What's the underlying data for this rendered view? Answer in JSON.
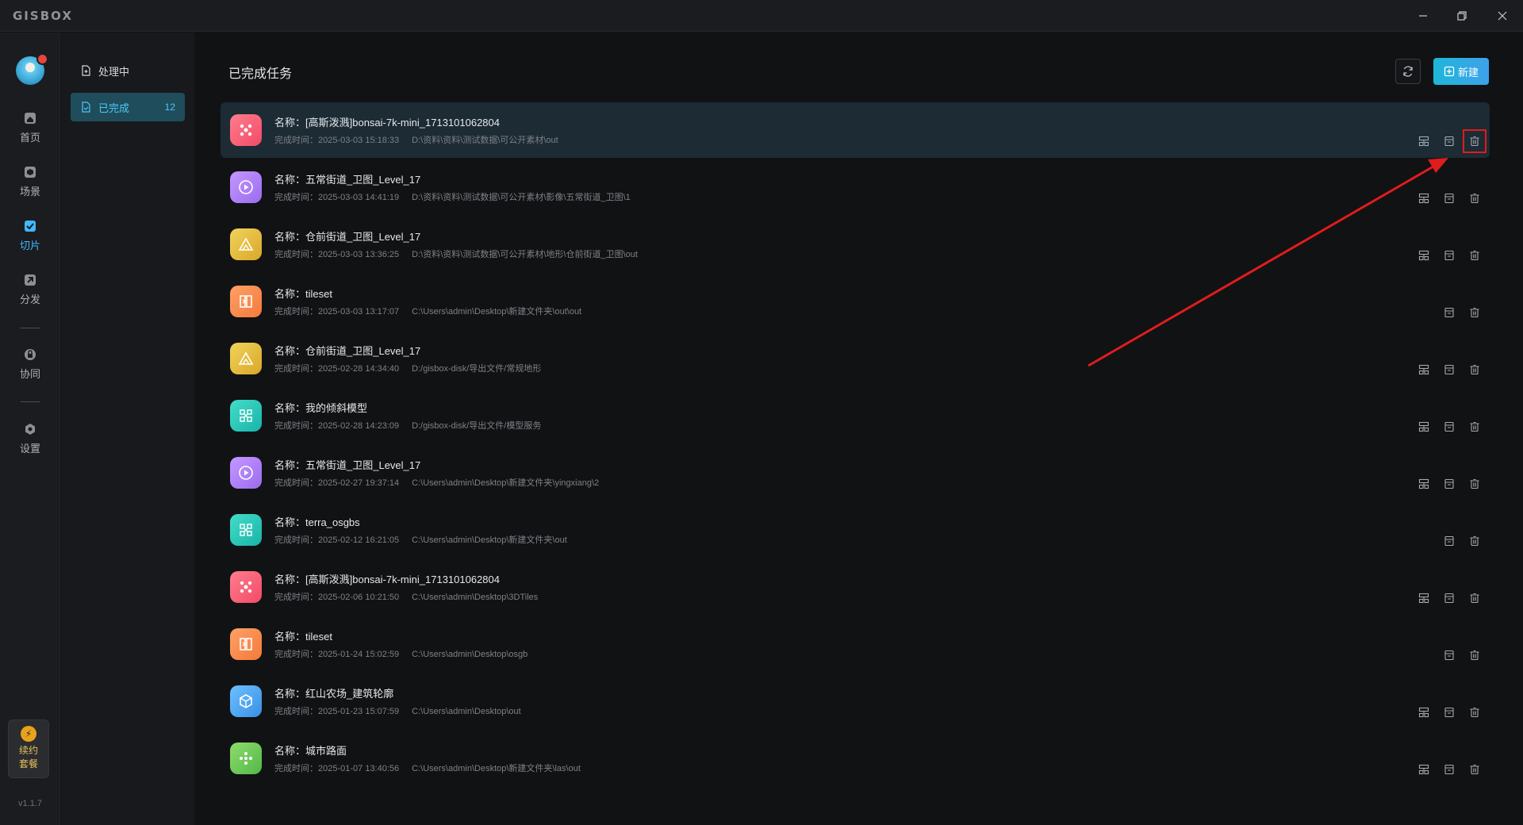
{
  "app": {
    "logo": "GISBOX",
    "version": "v1.1.7"
  },
  "rail": {
    "items": [
      {
        "label": "首页",
        "icon": "home-icon",
        "active": false
      },
      {
        "label": "场景",
        "icon": "scene-icon",
        "active": false
      },
      {
        "label": "切片",
        "icon": "slice-icon",
        "active": true
      },
      {
        "label": "分发",
        "icon": "distribute-icon",
        "active": false
      },
      {
        "label": "协同",
        "icon": "collaborate-icon",
        "active": false
      },
      {
        "label": "设置",
        "icon": "settings-icon",
        "active": false
      }
    ],
    "renew_line1": "续约",
    "renew_line2": "套餐"
  },
  "subnav": {
    "processing": "处理中",
    "completed": "已完成",
    "completed_count": "12"
  },
  "main": {
    "title": "已完成任务",
    "new_label": "新建",
    "name_prefix": "名称：",
    "time_prefix": "完成时间：",
    "tasks": [
      {
        "name": "[高斯泼溅]bonsai-7k-mini_1713101062804",
        "time": "2025-03-03 15:18:33",
        "path": "D:\\资料\\资料\\测试数据\\可公开素材\\out",
        "color": "pink",
        "icon": "gaussian-splat-icon",
        "selected": true,
        "has_publish": true
      },
      {
        "name": "五常街道_卫图_Level_17",
        "time": "2025-03-03 14:41:19",
        "path": "D:\\资料\\资料\\测试数据\\可公开素材\\影像\\五常街道_卫图\\1",
        "color": "purple",
        "icon": "imagery-icon",
        "selected": false,
        "has_publish": true
      },
      {
        "name": "仓前街道_卫图_Level_17",
        "time": "2025-03-03 13:36:25",
        "path": "D:\\资料\\资料\\测试数据\\可公开素材\\地形\\仓前街道_卫图\\out",
        "color": "yellow",
        "icon": "terrain-icon",
        "selected": false,
        "has_publish": true
      },
      {
        "name": "tileset",
        "time": "2025-03-03 13:17:07",
        "path": "C:\\Users\\admin\\Desktop\\新建文件夹\\out\\out",
        "color": "orange",
        "icon": "tileset-icon",
        "selected": false,
        "has_publish": false
      },
      {
        "name": "仓前街道_卫图_Level_17",
        "time": "2025-02-28 14:34:40",
        "path": "D:/gisbox-disk/导出文件/常规地形",
        "color": "yellow",
        "icon": "terrain-icon",
        "selected": false,
        "has_publish": true
      },
      {
        "name": "我的倾斜模型",
        "time": "2025-02-28 14:23:09",
        "path": "D:/gisbox-disk/导出文件/模型服务",
        "color": "teal",
        "icon": "oblique-model-icon",
        "selected": false,
        "has_publish": true
      },
      {
        "name": "五常街道_卫图_Level_17",
        "time": "2025-02-27 19:37:14",
        "path": "C:\\Users\\admin\\Desktop\\新建文件夹\\yingxiang\\2",
        "color": "purple",
        "icon": "imagery-icon",
        "selected": false,
        "has_publish": true
      },
      {
        "name": "terra_osgbs",
        "time": "2025-02-12 16:21:05",
        "path": "C:\\Users\\admin\\Desktop\\新建文件夹\\out",
        "color": "teal",
        "icon": "oblique-model-icon",
        "selected": false,
        "has_publish": false
      },
      {
        "name": "[高斯泼溅]bonsai-7k-mini_1713101062804",
        "time": "2025-02-06 10:21:50",
        "path": "C:\\Users\\admin\\Desktop\\3DTiles",
        "color": "pink",
        "icon": "gaussian-splat-icon",
        "selected": false,
        "has_publish": true
      },
      {
        "name": "tileset",
        "time": "2025-01-24 15:02:59",
        "path": "C:\\Users\\admin\\Desktop\\osgb",
        "color": "orange",
        "icon": "tileset-icon",
        "selected": false,
        "has_publish": false
      },
      {
        "name": "红山农场_建筑轮廓",
        "time": "2025-01-23 15:07:59",
        "path": "C:\\Users\\admin\\Desktop\\out",
        "color": "blue",
        "icon": "building-outline-icon",
        "selected": false,
        "has_publish": true
      },
      {
        "name": "城市路面",
        "time": "2025-01-07 13:40:56",
        "path": "C:\\Users\\admin\\Desktop\\新建文件夹\\las\\out",
        "color": "green",
        "icon": "point-cloud-icon",
        "selected": false,
        "has_publish": true
      }
    ]
  }
}
